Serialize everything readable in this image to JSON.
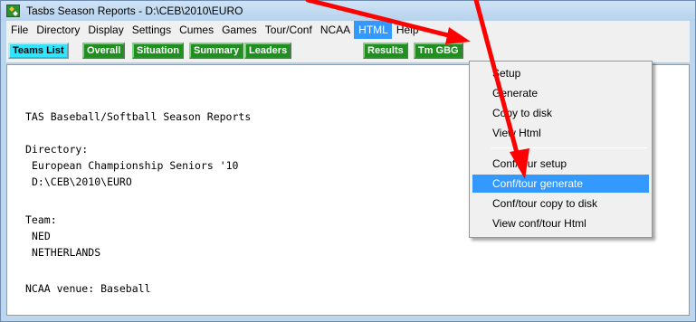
{
  "window": {
    "title": "Tasbs Season Reports - D:\\CEB\\2010\\EURO"
  },
  "menubar": {
    "items": [
      {
        "label": "File"
      },
      {
        "label": "Directory"
      },
      {
        "label": "Display"
      },
      {
        "label": "Settings"
      },
      {
        "label": "Cumes"
      },
      {
        "label": "Games"
      },
      {
        "label": "Tour/Conf"
      },
      {
        "label": "NCAA"
      },
      {
        "label": "HTML"
      },
      {
        "label": "Help"
      }
    ]
  },
  "toolbar": {
    "buttons": [
      {
        "label": "Teams List",
        "color": "#2ee6ff"
      },
      {
        "label": "Overall",
        "color": "#1f8f1f"
      },
      {
        "label": "Situation",
        "color": "#1f8f1f"
      },
      {
        "label": "Summary",
        "color": "#1f8f1f"
      },
      {
        "label": "Leaders",
        "color": "#1f8f1f"
      },
      {
        "label": "Results",
        "color": "#1f8f1f"
      },
      {
        "label": "Tm GBG",
        "color": "#1f8f1f"
      }
    ]
  },
  "content": {
    "heading": "TAS Baseball/Softball Season Reports",
    "directory_label": "Directory:",
    "directory_name": "European Championship Seniors '10",
    "directory_path": "D:\\CEB\\2010\\EURO",
    "team_label": "Team:",
    "team_code": "NED",
    "team_name": "NETHERLANDS",
    "venue": "NCAA venue: Baseball"
  },
  "html_menu": {
    "items": [
      {
        "label": "Setup"
      },
      {
        "label": "Generate"
      },
      {
        "label": "Copy to disk"
      },
      {
        "label": "View Html"
      },
      {
        "label": "Conf/tour setup"
      },
      {
        "label": "Conf/tour generate"
      },
      {
        "label": "Conf/tour copy to disk"
      },
      {
        "label": "View conf/tour Html"
      }
    ],
    "highlighted": "Conf/tour generate"
  },
  "colors": {
    "annotation_arrow": "#ff0000",
    "menu_highlight": "#3399ff",
    "button_green": "#1f8f1f",
    "button_cyan": "#2ee6ff"
  }
}
